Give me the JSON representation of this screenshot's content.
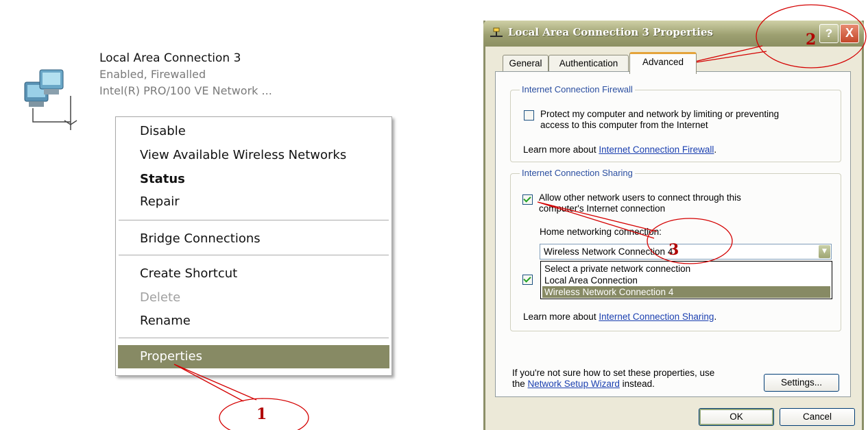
{
  "left": {
    "connection": {
      "title": "Local Area Connection 3",
      "status": "Enabled, Firewalled",
      "device": "Intel(R) PRO/100 VE Network ..."
    },
    "context_menu": {
      "items": [
        {
          "label": "Disable"
        },
        {
          "label": "View Available Wireless Networks"
        },
        {
          "label": "Status"
        },
        {
          "label": "Repair"
        },
        {
          "label": "Bridge Connections"
        },
        {
          "label": "Create Shortcut"
        },
        {
          "label": "Delete"
        },
        {
          "label": "Rename"
        },
        {
          "label": "Properties"
        }
      ]
    }
  },
  "dialog": {
    "title": "Local Area Connection 3 Properties",
    "help_glyph": "?",
    "close_glyph": "X",
    "tabs": [
      {
        "label": "General"
      },
      {
        "label": "Authentication"
      },
      {
        "label": "Advanced"
      }
    ],
    "firewall": {
      "group_title": "Internet Connection Firewall",
      "checkbox_line1": "Protect my computer and network by limiting or preventing",
      "checkbox_line2": "access to this computer from the Internet",
      "learn_prefix": "Learn more about ",
      "learn_link": "Internet Connection Firewall",
      "learn_suffix": "."
    },
    "sharing": {
      "group_title": "Internet Connection Sharing",
      "allow_line1": "Allow other network users to connect through this",
      "allow_line2": "computer's Internet connection",
      "home_label": "Home networking connection:",
      "selected": "Wireless Network Connection 4",
      "options": [
        "Select a private network connection",
        "Local Area Connection",
        "Wireless Network Connection 4"
      ],
      "learn_prefix": "Learn more about ",
      "learn_link": "Internet Connection Sharing",
      "learn_suffix": "."
    },
    "footer": {
      "line1": "If you're not sure how to set these properties, use",
      "line2_prefix": "the ",
      "wizard_link": "Network Setup Wizard",
      "line2_suffix": " instead.",
      "settings_button": "Settings...",
      "ok_button": "OK",
      "cancel_button": "Cancel"
    }
  },
  "annotations": {
    "callout_1": "1",
    "callout_2": "2",
    "callout_3": "3",
    "color": "#d40000"
  },
  "colors": {
    "selection_olive": "#878a64",
    "titlebar_olive": "#9da071",
    "link_blue": "#1a3fb0"
  }
}
